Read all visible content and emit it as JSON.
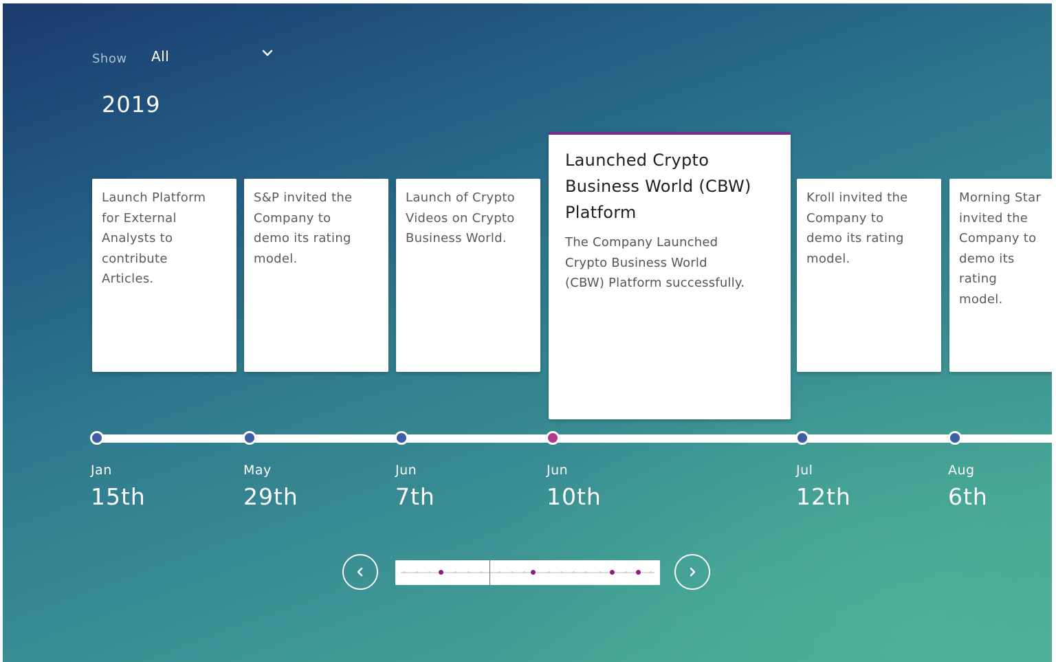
{
  "filter": {
    "label": "Show",
    "value": "All"
  },
  "year": "2019",
  "events": [
    {
      "month": "Jan",
      "day": "15th",
      "text": "Launch Platform\nfor External\nAnalysts to\ncontribute\nArticles."
    },
    {
      "month": "May",
      "day": "29th",
      "text": "S&P invited the\nCompany to\ndemo its rating\nmodel."
    },
    {
      "month": "Jun",
      "day": "7th",
      "text": "Launch of Crypto\nVideos on Crypto\nBusiness World."
    },
    {
      "month": "Jun",
      "day": "10th",
      "title": "Launched Crypto\nBusiness World (CBW)\nPlatform",
      "text": "The Company Launched\nCrypto Business World\n(CBW) Platform successfully.",
      "active": true
    },
    {
      "month": "Jul",
      "day": "12th",
      "text": "Kroll invited the\nCompany to\ndemo its rating\nmodel."
    },
    {
      "month": "Aug",
      "day": "6th",
      "text": "Morning Star\ninvited the\nCompany to\ndemo its rating\nmodel."
    }
  ],
  "colors": {
    "dot": "#3b5fa4",
    "dot_active": "#b03a8e",
    "minimap_dot": "#8a1e7c",
    "active_card_accent": "#7b2d8e"
  },
  "icons": {
    "dropdown": "chevron-down-icon",
    "prev": "chevron-left-icon",
    "next": "chevron-right-icon"
  }
}
